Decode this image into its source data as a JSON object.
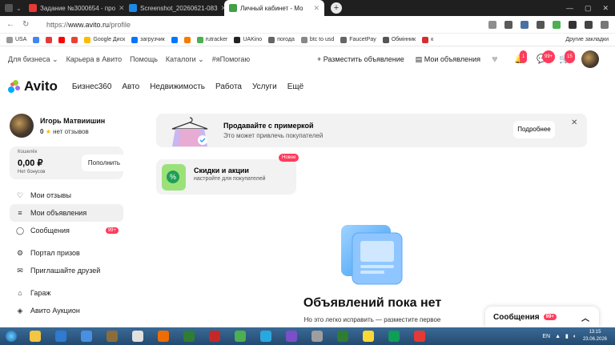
{
  "browser": {
    "tabs": [
      {
        "title": "Задание №3000654 - про",
        "color": "#e53935",
        "active": false
      },
      {
        "title": "Screenshot_20260621-083",
        "color": "#1e88e5",
        "active": false
      },
      {
        "title": "Личный кабинет - Mo",
        "color": "#43a047",
        "active": true
      }
    ],
    "address": {
      "scheme": "https://",
      "host": "www.avito.ru",
      "path": "/profile"
    },
    "bookmarks": [
      {
        "label": "USA",
        "color": "#999"
      },
      {
        "label": "",
        "color": "#4285f4"
      },
      {
        "label": "",
        "color": "#e53935"
      },
      {
        "label": "",
        "color": "#ff0000"
      },
      {
        "label": "",
        "color": "#ea4335"
      },
      {
        "label": "Google Диск",
        "color": "#fbbc04"
      },
      {
        "label": "загрузчик",
        "color": "#0077ff"
      },
      {
        "label": "",
        "color": "#0077ff"
      },
      {
        "label": "",
        "color": "#f57c00"
      },
      {
        "label": "rutracker",
        "color": "#4caf50"
      },
      {
        "label": "UAKino",
        "color": "#222"
      },
      {
        "label": "погода",
        "color": "#666"
      },
      {
        "label": "btc to usd",
        "color": "#888"
      },
      {
        "label": "FaucetPay",
        "color": "#666"
      },
      {
        "label": "Обмінник",
        "color": "#555"
      },
      {
        "label": "к",
        "color": "#d32f2f"
      }
    ],
    "bookmarks_more": "Другие закладки"
  },
  "site": {
    "topnav": {
      "business": "Для бизнеса",
      "career": "Карьера в Авито",
      "help": "Помощь",
      "catalogs": "Каталоги",
      "tag": "#яПомогаю",
      "post_ad": "+ Разместить объявление",
      "my_ads": "Мои объявления",
      "notif_count": "1",
      "msg_count": "99+",
      "cart_count": "15"
    },
    "logo": "Avito",
    "mainnav": [
      "Бизнес360",
      "Авто",
      "Недвижимость",
      "Работа",
      "Услуги",
      "Ещё"
    ]
  },
  "profile": {
    "name": "Игорь Матвиишин",
    "rating": "0",
    "reviews": "нет отзывов",
    "wallet_label": "Кошелёк",
    "wallet_amount": "0,00 ₽",
    "bonus": "Нет бонусов",
    "topup": "Пополнить"
  },
  "menu": [
    {
      "label": "Мои отзывы",
      "icon": "heart-hand-icon",
      "glyph": "♡"
    },
    {
      "label": "Мои объявления",
      "icon": "list-icon",
      "glyph": "≡",
      "active": true
    },
    {
      "label": "Сообщения",
      "icon": "chat-icon",
      "glyph": "◯",
      "badge": "99+"
    },
    {
      "label": "Портал призов",
      "icon": "gear-icon",
      "glyph": "⚙"
    },
    {
      "label": "Приглашайте друзей",
      "icon": "gift-icon",
      "glyph": "✉"
    },
    {
      "label": "Гараж",
      "icon": "car-icon",
      "glyph": "⌂"
    },
    {
      "label": "Авито Аукцион",
      "icon": "auction-icon",
      "glyph": "◈"
    }
  ],
  "promo": {
    "title": "Продавайте с примеркой",
    "subtitle": "Это может привлечь покупателей",
    "button": "Подробнее",
    "close": "✕"
  },
  "sale": {
    "title": "Скидки и акции",
    "subtitle": "настройте для покупателей",
    "badge": "Новое",
    "pct": "%"
  },
  "empty": {
    "title": "Объявлений пока нет",
    "subtitle": "Но это легко исправить — разместите первое"
  },
  "messages_panel": {
    "label": "Сообщения",
    "count": "99+"
  },
  "taskbar": {
    "lang": "EN",
    "time": "13:15",
    "date": "23.06.2026",
    "apps": [
      "#f4c542",
      "#2e7bcf",
      "#4a90e2",
      "#8a6d3b",
      "#e0e0e0",
      "#ef6c00",
      "#2e7d32",
      "#c62828",
      "#4caf50",
      "#29a8e0",
      "#7b4fc9",
      "#9e9e9e",
      "#2e7d32",
      "#fdd835",
      "#0f9d58",
      "#e53935"
    ]
  }
}
